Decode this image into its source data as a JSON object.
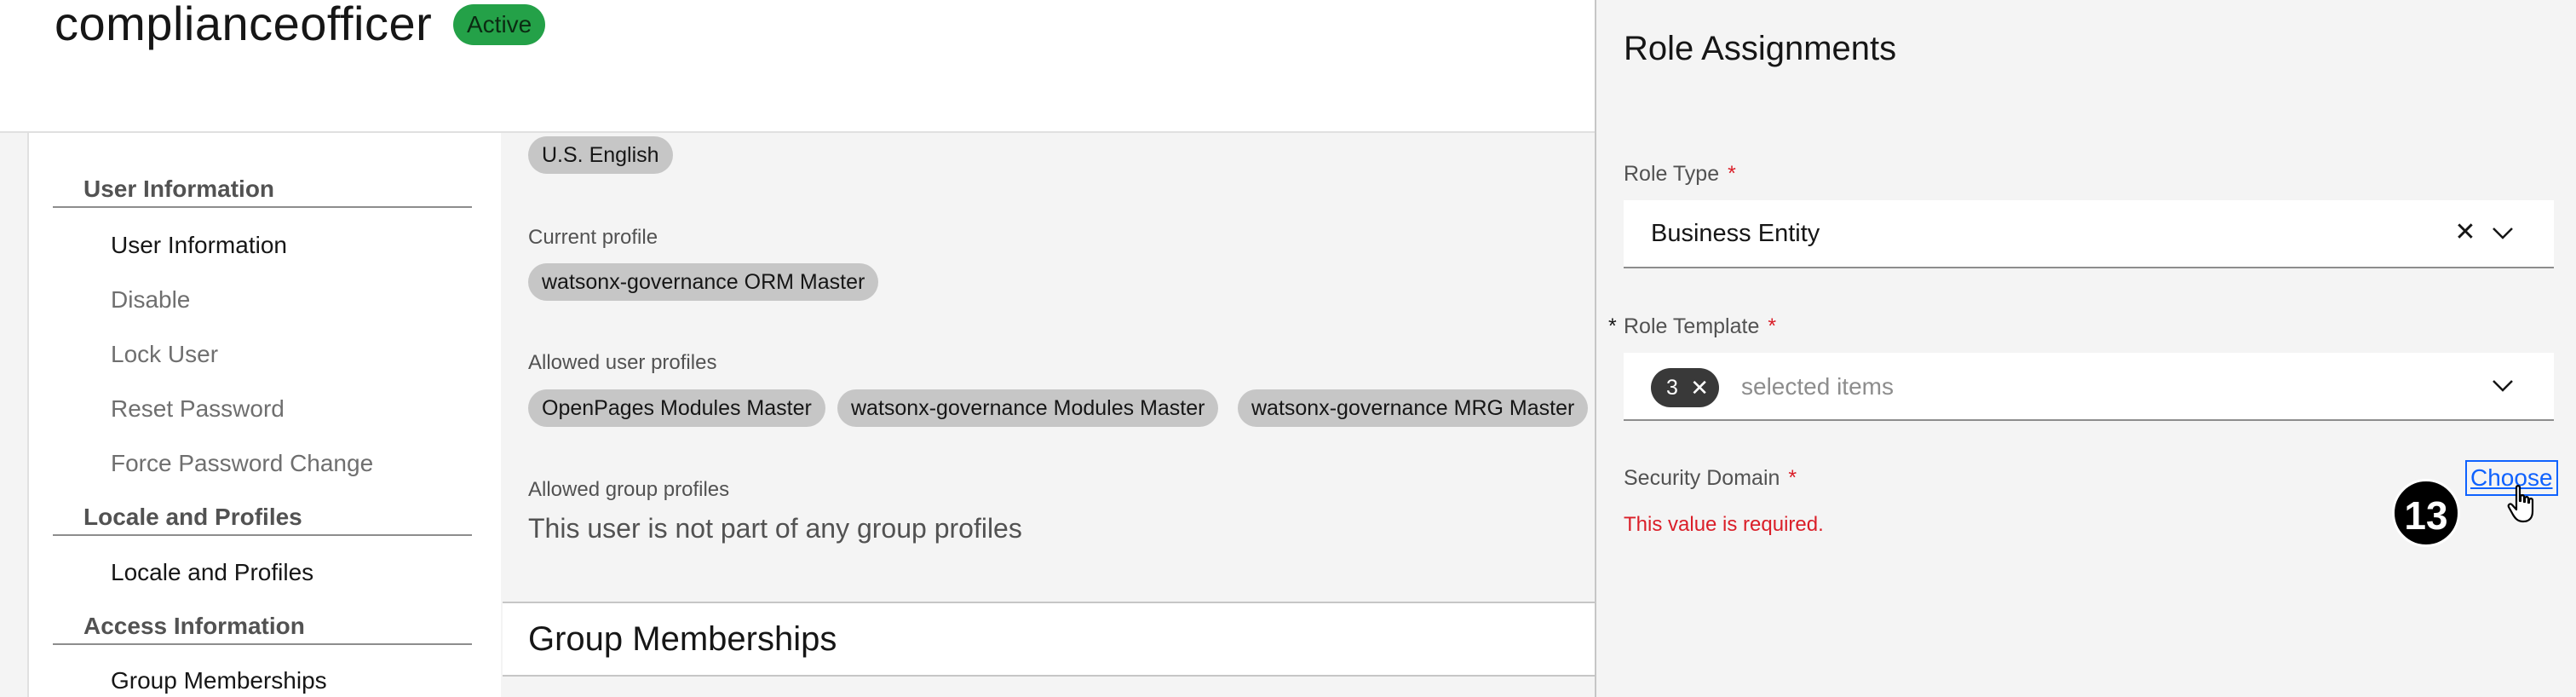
{
  "header": {
    "username": "complianceofficer",
    "status": "Active"
  },
  "sidebar": {
    "sections": [
      {
        "label": "User Information",
        "items": [
          {
            "label": "User Information",
            "active": true
          },
          {
            "label": "Disable",
            "active": false
          },
          {
            "label": "Lock User",
            "active": false
          },
          {
            "label": "Reset Password",
            "active": false
          },
          {
            "label": "Force Password Change",
            "active": false
          }
        ]
      },
      {
        "label": "Locale and Profiles",
        "items": [
          {
            "label": "Locale and Profiles",
            "active": true
          }
        ]
      },
      {
        "label": "Access Information",
        "items": [
          {
            "label": "Group Memberships",
            "active": true
          }
        ]
      }
    ]
  },
  "main": {
    "locale_chip": "U.S. English",
    "current_profile_label": "Current profile",
    "current_profile_chip": "watsonx-governance ORM Master",
    "allowed_user_profiles_label": "Allowed user profiles",
    "allowed_user_profiles": [
      "OpenPages Modules Master",
      "watsonx-governance Modules Master",
      "watsonx-governance MRG Master"
    ],
    "allowed_group_profiles_label": "Allowed group profiles",
    "allowed_group_profiles_value": "This user is not part of any group profiles",
    "group_memberships_title": "Group Memberships"
  },
  "panel": {
    "title": "Role Assignments",
    "role_type_label": "Role Type",
    "required_mark": "*",
    "role_type_value": "Business Entity",
    "role_template_label": "Role Template",
    "role_template_count": "3",
    "role_template_placeholder": "selected items",
    "security_domain_label": "Security Domain",
    "choose_link": "Choose",
    "error_text": "This value is required.",
    "step_badge": "13"
  },
  "icons": {
    "clear": "close-icon",
    "chevron": "chevron-down-icon",
    "cursor": "hand-pointer-icon"
  },
  "colors": {
    "status_green": "#24a148",
    "error_red": "#da1e28",
    "link_blue": "#0f62fe",
    "chip_gray": "#c6c6c6",
    "tag_dark": "#393939"
  }
}
